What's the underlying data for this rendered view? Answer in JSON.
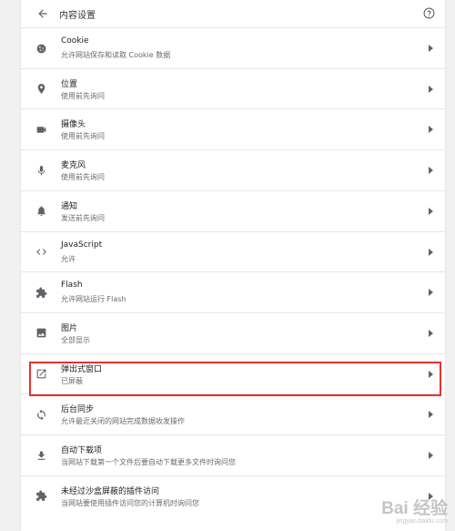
{
  "header": {
    "title": "内容设置"
  },
  "rows": [
    {
      "label": "Cookie",
      "sub": "允许网站保存和读取 Cookie 数据",
      "icon": "cookie-icon"
    },
    {
      "label": "位置",
      "sub": "使用前先询问",
      "icon": "location-icon"
    },
    {
      "label": "摄像头",
      "sub": "使用前先询问",
      "icon": "camera-icon"
    },
    {
      "label": "麦克风",
      "sub": "使用前先询问",
      "icon": "microphone-icon"
    },
    {
      "label": "通知",
      "sub": "发送前先询问",
      "icon": "bell-icon"
    },
    {
      "label": "JavaScript",
      "sub": "允许",
      "icon": "code-icon"
    },
    {
      "label": "Flash",
      "sub": "允许网站运行 Flash",
      "icon": "puzzle-icon"
    },
    {
      "label": "图片",
      "sub": "全部显示",
      "icon": "image-icon"
    },
    {
      "label": "弹出式窗口",
      "sub": "已屏蔽",
      "icon": "open-in-new-icon"
    },
    {
      "label": "后台同步",
      "sub": "允许最近关闭的网站完成数据收发操作",
      "icon": "sync-icon"
    },
    {
      "label": "自动下载项",
      "sub": "当网站下载第一个文件后要自动下载更多文件时询问您",
      "icon": "download-icon"
    },
    {
      "label": "未经过沙盒屏蔽的插件访问",
      "sub": "当网站要使用插件访问您的计算机时询问您",
      "icon": "puzzle-icon"
    }
  ],
  "watermark": {
    "main": "Bai 经验",
    "sub": "jingyan.baidu.com"
  },
  "colors": {
    "highlight": "#e5322d",
    "icon": "#5f6368"
  }
}
